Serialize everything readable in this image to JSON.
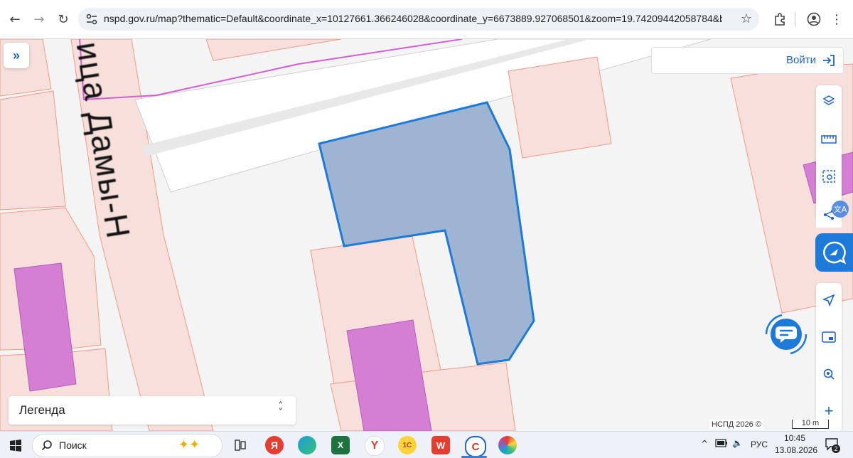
{
  "browser": {
    "url": "nspd.gov.ru/map?thematic=Default&coordinate_x=10127661.366246028&coordinate_y=6673889.927068501&zoom=19.74209442058784&baseLayer..."
  },
  "map": {
    "street_label": "ица Дамы-Н",
    "login_label": "Войти",
    "legend_label": "Легенда",
    "attribution": "НСПД 2026 ©",
    "scale_label": "10 m"
  },
  "taskbar": {
    "search_placeholder": "Поиск",
    "language": "РУС",
    "time": "10:45",
    "date": "13.08.2026",
    "notification_count": "2"
  },
  "colors": {
    "accent": "#1e7ad8",
    "parcel_fill": "#9db5d2",
    "building_magenta": "#d47fd4",
    "parcel_pink": "#f7e0dc"
  }
}
